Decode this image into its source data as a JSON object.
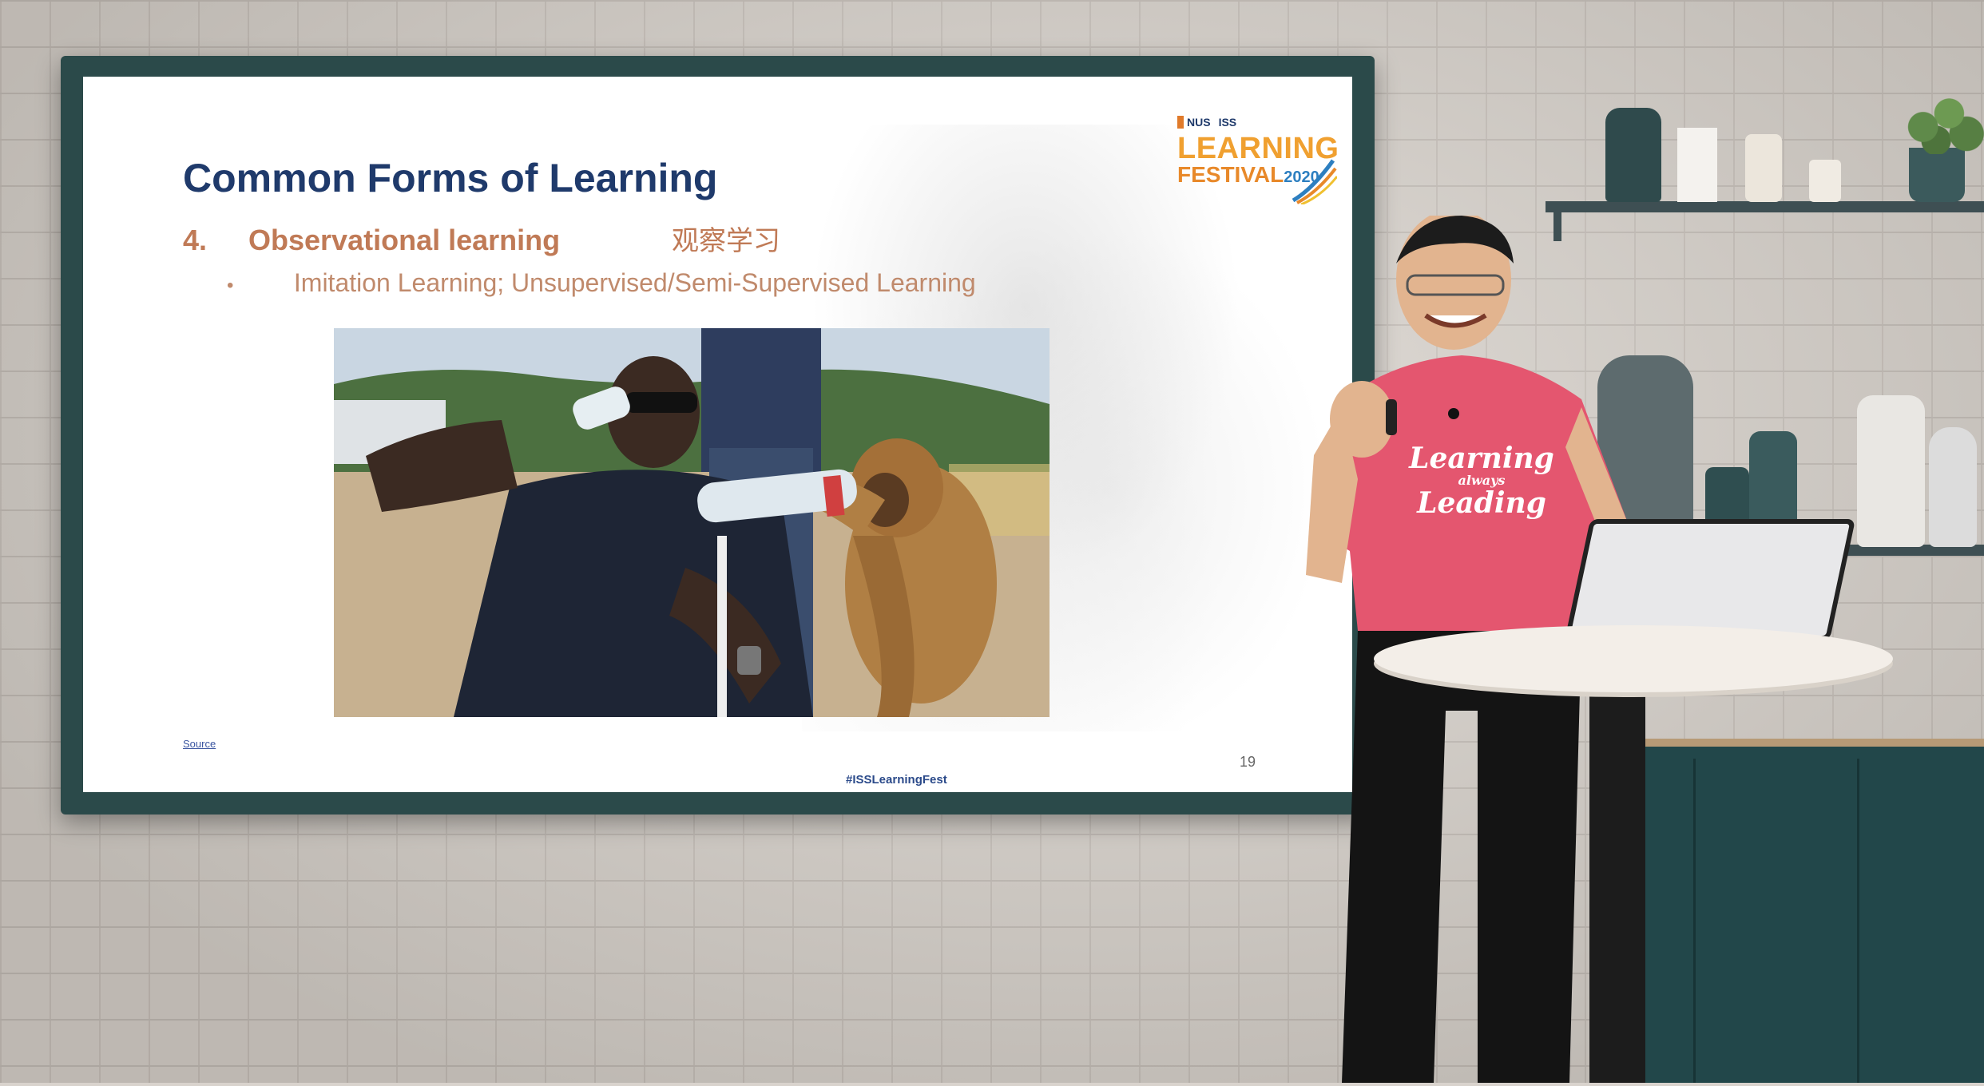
{
  "slide": {
    "title": "Common Forms of Learning",
    "point_number": "4.",
    "point_label": "Observational learning",
    "point_chinese": "观察学习",
    "sub_bullet": "•",
    "sub_text": "Imitation Learning; Unsupervised/Semi-Supervised Learning",
    "source_label": "Source",
    "page_number": "19",
    "hashtag": "#ISSLearningFest"
  },
  "logo": {
    "nus": "NUS",
    "iss": "ISS",
    "line1": "LEARNING",
    "line2": "FESTIVAL",
    "year": "2020"
  },
  "shirt": {
    "line1": "Learning",
    "line2": "always",
    "line3": "Leading"
  },
  "colors": {
    "title": "#1f3a6b",
    "point": "#c07a56",
    "screen_frame": "#2b4a4a",
    "shirt": "#e4566f",
    "cabinet": "#22474a"
  }
}
